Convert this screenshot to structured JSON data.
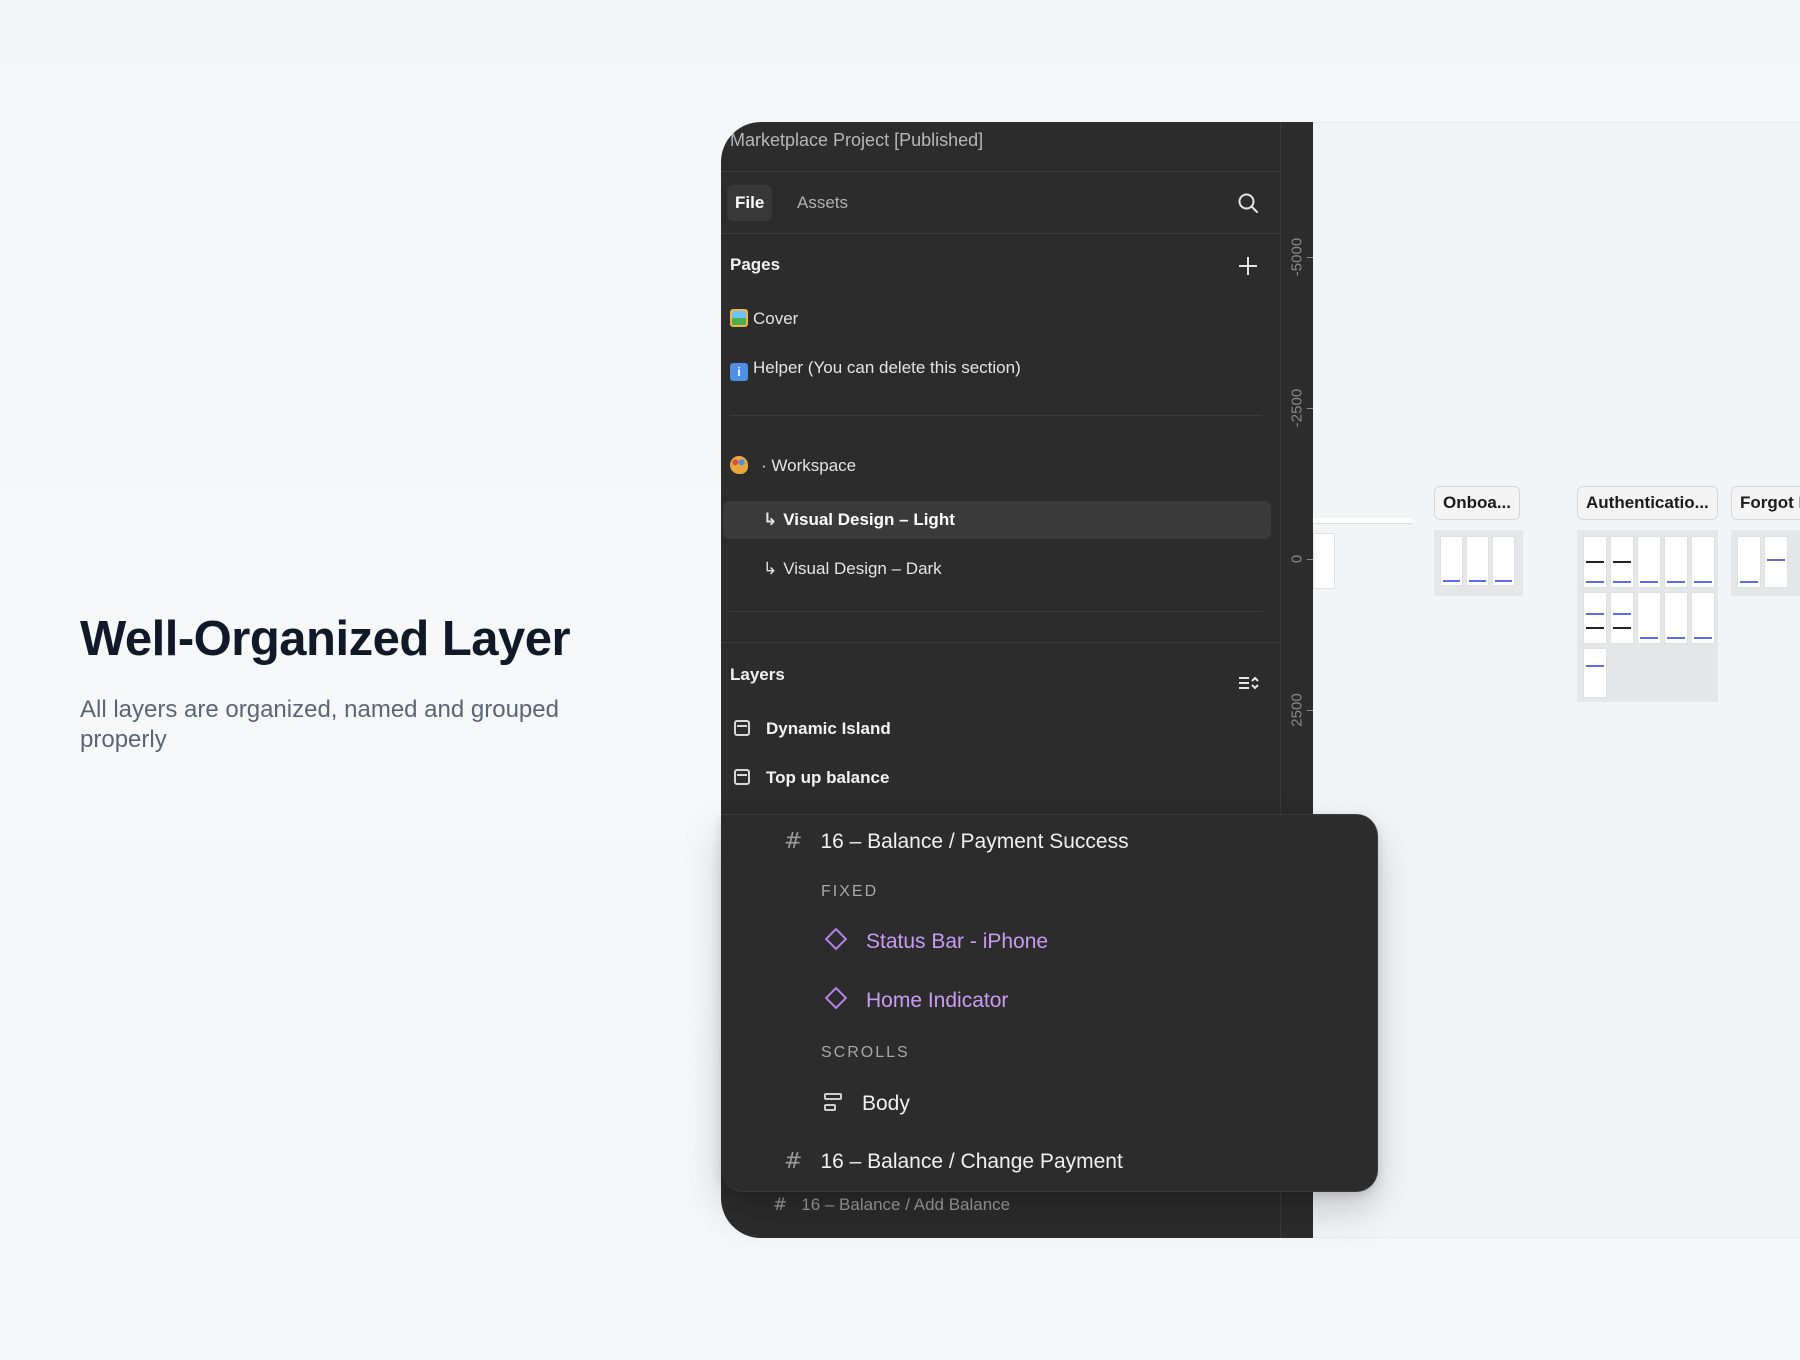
{
  "hero": {
    "title": "Well-Organized Layer",
    "subtitle": "All layers are organized, named and grouped properly"
  },
  "app": {
    "title": "Marketplace Project [Published]",
    "tabs": {
      "file": "File",
      "assets": "Assets"
    },
    "pages": {
      "label": "Pages",
      "items": [
        {
          "label": "Cover",
          "icon": "cover-emoji-icon"
        },
        {
          "label": "Helper (You can delete this section)",
          "icon": "info-emoji-icon"
        },
        {
          "label": "·  Workspace",
          "icon": "palette-emoji-icon"
        },
        {
          "label": "Visual Design – Light",
          "active": true
        },
        {
          "label": "Visual Design – Dark"
        }
      ]
    },
    "layers": {
      "label": "Layers",
      "items": [
        {
          "label": "Dynamic Island"
        },
        {
          "label": "Top up balance"
        }
      ],
      "popup": {
        "frame1": "16 – Balance / Payment Success",
        "group_fixed": "FIXED",
        "comp1": "Status Bar - iPhone",
        "comp2": "Home Indicator",
        "group_scrolls": "SCROLLS",
        "body": "Body",
        "frame2": "16 – Balance / Change Payment"
      },
      "bottom_item": "16 – Balance / Add Balance"
    },
    "ruler": [
      "-5000",
      "-2500",
      "0",
      "2500"
    ],
    "canvas": {
      "sections": [
        "Onboa...",
        "Authenticatio...",
        "Forgot Pa"
      ]
    },
    "colors": {
      "sidebar_bg": "#2c2c2c",
      "component_purple": "#c99cf4",
      "canvas_bg": "#f3f4f6",
      "accent_blue": "#5b6cf0"
    }
  }
}
